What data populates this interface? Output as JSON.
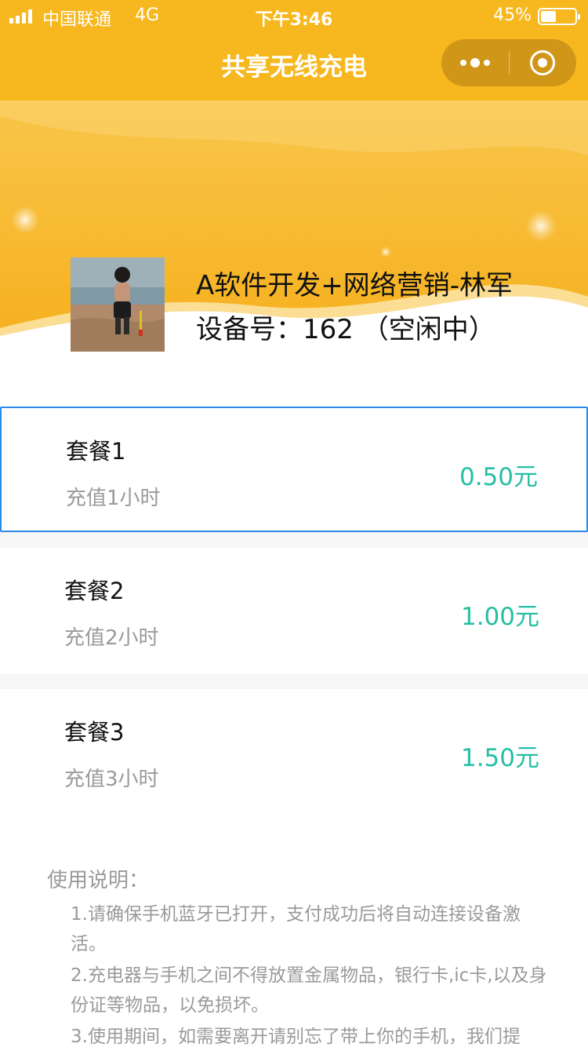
{
  "status_bar": {
    "carrier": "中国联通",
    "network": "4G",
    "time": "下午3:46",
    "battery_percent": "45%",
    "battery_level": 0.45
  },
  "nav": {
    "title": "共享无线充电",
    "more_icon": "more-dots-icon",
    "close_icon": "target-close-icon"
  },
  "device": {
    "name": "A软件开发+网络营销-林军",
    "status_line": "设备号：162 （空闲中）"
  },
  "packages": [
    {
      "name": "套餐1",
      "desc": "充值1小时",
      "price": "0.50元",
      "selected": true
    },
    {
      "name": "套餐2",
      "desc": "充值2小时",
      "price": "1.00元",
      "selected": false
    },
    {
      "name": "套餐3",
      "desc": "充值3小时",
      "price": "1.50元",
      "selected": false
    }
  ],
  "instructions": {
    "title": "使用说明：",
    "items": [
      "1.请确保手机蓝牙已打开，支付成功后将自动连接设备激活。",
      "2.充电器与手机之间不得放置金属物品，银行卡,ic卡,以及身份证等物品，以免损坏。",
      "3.使用期间，如需要离开请别忘了带上你的手机，我们提"
    ]
  },
  "colors": {
    "brand_yellow": "#f7b71e",
    "price_teal": "#25bfa4",
    "selected_border": "#2a8ae6",
    "muted_text": "#9a9a9a"
  }
}
